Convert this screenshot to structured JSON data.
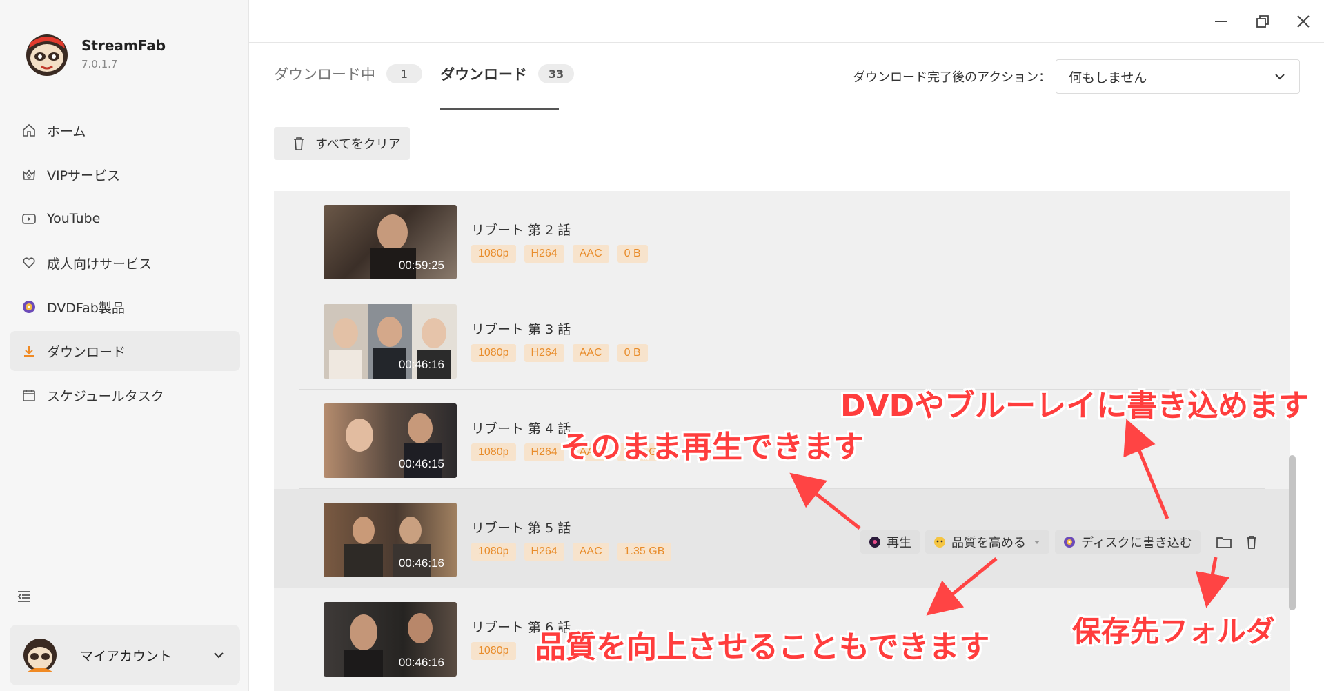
{
  "app": {
    "name": "StreamFab",
    "version": "7.0.1.7"
  },
  "sidebar": {
    "items": [
      {
        "label": "ホーム",
        "icon": "home-icon"
      },
      {
        "label": "VIPサービス",
        "icon": "vip-icon"
      },
      {
        "label": "YouTube",
        "icon": "youtube-icon"
      },
      {
        "label": "成人向けサービス",
        "icon": "heart-icon"
      },
      {
        "label": "DVDFab製品",
        "icon": "dvdfab-icon"
      },
      {
        "label": "ダウンロード",
        "icon": "download-icon",
        "active": true
      },
      {
        "label": "スケジュールタスク",
        "icon": "calendar-icon"
      }
    ],
    "account_label": "マイアカウント"
  },
  "tabs": [
    {
      "label": "ダウンロード中",
      "count": "1"
    },
    {
      "label": "ダウンロード",
      "count": "33"
    }
  ],
  "after_action": {
    "label": "ダウンロード完了後のアクション：",
    "value": "何もしません"
  },
  "clear_all_label": "すべてをクリア",
  "rows": [
    {
      "title": "リブート 第 2 話",
      "duration": "00:59:25",
      "badges": [
        "1080p",
        "H264",
        "AAC",
        "0 B"
      ]
    },
    {
      "title": "リブート 第 3 話",
      "duration": "00:46:16",
      "badges": [
        "1080p",
        "H264",
        "AAC",
        "0 B"
      ]
    },
    {
      "title": "リブート 第 4 話",
      "duration": "00:46:15",
      "badges": [
        "1080p",
        "H264",
        "AAC",
        "1.35 GB"
      ]
    },
    {
      "title": "リブート 第 5 話",
      "duration": "00:46:16",
      "badges": [
        "1080p",
        "H264",
        "AAC",
        "1.35 GB"
      ]
    },
    {
      "title": "リブート 第 6 話",
      "duration": "00:46:16",
      "badges": [
        "1080p"
      ]
    }
  ],
  "row_actions": {
    "play": "再生",
    "enhance": "品質を高める",
    "burn": "ディスクに書き込む"
  },
  "annotations": {
    "play": "そのまま再生できます",
    "burn": "DVDやブルーレイに書き込めます",
    "enhance": "品質を向上させることもできます",
    "folder": "保存先フォルダ"
  },
  "colors": {
    "badge_text": "#e88c2b",
    "badge_bg": "#f7e3cc",
    "annotation": "#ff3d3d",
    "download_accent": "#f08a24"
  }
}
